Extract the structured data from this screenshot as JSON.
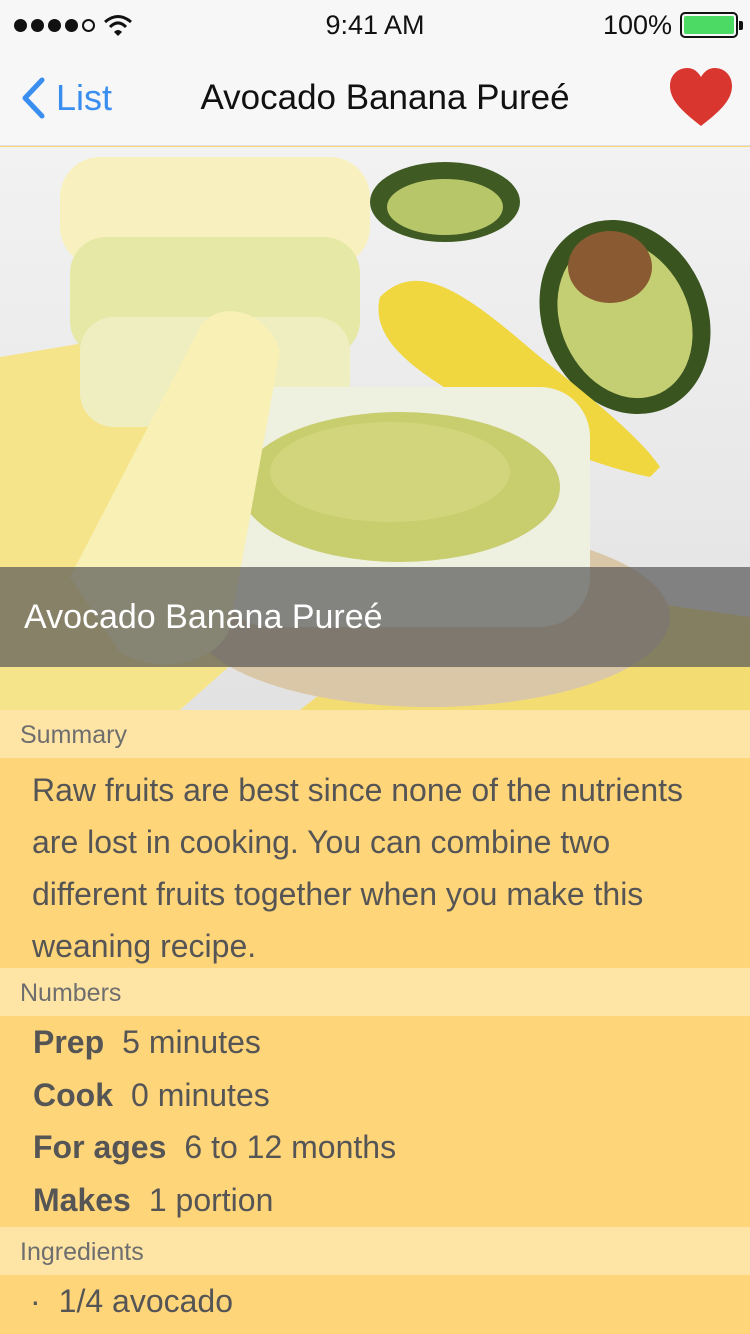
{
  "status": {
    "time": "9:41 AM",
    "battery": "100%"
  },
  "nav": {
    "back_label": "List",
    "title": "Avocado Banana Pureé"
  },
  "hero": {
    "caption": "Avocado Banana Pureé"
  },
  "sections": {
    "summary_header": "Summary",
    "summary_text": "Raw fruits are best since none of the nutrients are lost in cooking. You can combine two different fruits together when you make this weaning recipe.",
    "numbers_header": "Numbers",
    "numbers": [
      {
        "label": "Prep",
        "value": "5 minutes"
      },
      {
        "label": "Cook",
        "value": "0 minutes"
      },
      {
        "label": "For ages",
        "value": "6 to 12 months"
      },
      {
        "label": "Makes",
        "value": "1 portion"
      }
    ],
    "ingredients_header": "Ingredients",
    "ingredients": [
      {
        "bullet": "·",
        "text": "1/4 avocado"
      }
    ]
  },
  "colors": {
    "accent": "#3a8ef0",
    "heart": "#d9362f",
    "section_bg": "#ffd57a",
    "header_bg": "#ffe5a5"
  }
}
